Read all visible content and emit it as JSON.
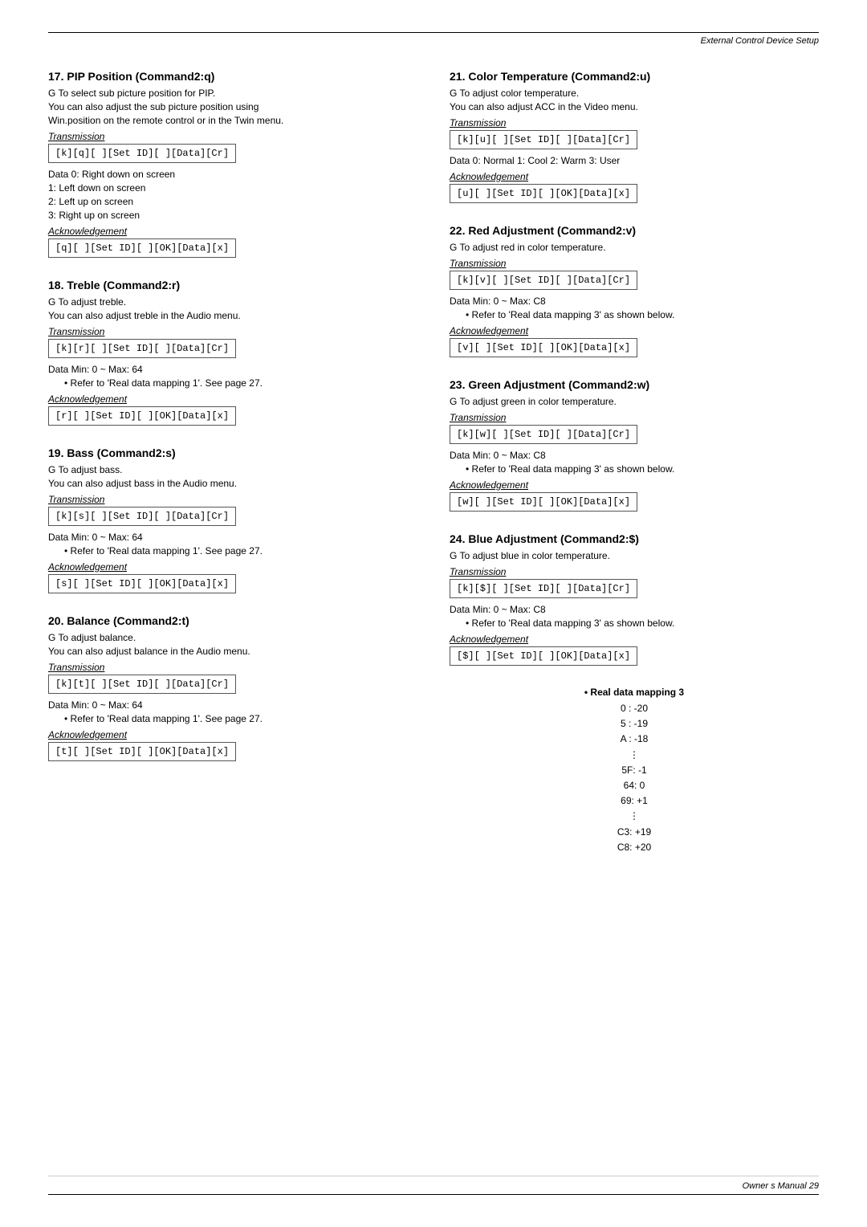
{
  "header": {
    "text": "External Control Device Setup"
  },
  "footer": {
    "text": "Owner s Manual  29"
  },
  "left_column": [
    {
      "id": "section-17",
      "title": "17. PIP Position (Command2:q)",
      "description_lines": [
        "G  To select sub picture position for PIP.",
        "     You can also adjust the sub picture position using",
        "     Win.position on the remote control or in the Twin menu."
      ],
      "transmission_label": "Transmission",
      "transmission_cmd": "[k][q][   ][Set ID][   ][Data][Cr]",
      "data_lines": [
        "Data  0: Right down on screen",
        "         1: Left down on screen",
        "         2: Left up on screen",
        "         3: Right up on screen"
      ],
      "ack_label": "Acknowledgement",
      "ack_cmd": "[q][   ][Set ID][   ][OK][Data][x]",
      "bullets": []
    },
    {
      "id": "section-18",
      "title": "18. Treble (Command2:r)",
      "description_lines": [
        "G  To adjust treble.",
        "     You can also adjust treble in the Audio menu."
      ],
      "transmission_label": "Transmission",
      "transmission_cmd": "[k][r][   ][Set ID][   ][Data][Cr]",
      "data_lines": [
        "Data  Min: 0 ~ Max: 64"
      ],
      "ack_label": "Acknowledgement",
      "ack_cmd": "[r][   ][Set ID][   ][OK][Data][x]",
      "bullets": [
        "Refer to 'Real data mapping 1'. See page 27."
      ]
    },
    {
      "id": "section-19",
      "title": "19. Bass (Command2:s)",
      "description_lines": [
        "G  To adjust bass.",
        "     You can also adjust bass in the Audio menu."
      ],
      "transmission_label": "Transmission",
      "transmission_cmd": "[k][s][   ][Set ID][   ][Data][Cr]",
      "data_lines": [
        "Data  Min: 0 ~ Max: 64"
      ],
      "ack_label": "Acknowledgement",
      "ack_cmd": "[s][   ][Set ID][   ][OK][Data][x]",
      "bullets": [
        "Refer to 'Real data mapping 1'. See page 27."
      ]
    },
    {
      "id": "section-20",
      "title": "20. Balance (Command2:t)",
      "description_lines": [
        "G  To adjust balance.",
        "     You can also adjust balance in the Audio menu."
      ],
      "transmission_label": "Transmission",
      "transmission_cmd": "[k][t][   ][Set ID][   ][Data][Cr]",
      "data_lines": [
        "Data  Min: 0 ~ Max: 64"
      ],
      "ack_label": "Acknowledgement",
      "ack_cmd": "[t][   ][Set ID][   ][OK][Data][x]",
      "bullets": [
        "Refer to 'Real data mapping 1'. See page 27."
      ]
    }
  ],
  "right_column": [
    {
      "id": "section-21",
      "title": "21. Color Temperature (Command2:u)",
      "description_lines": [
        "G  To adjust color temperature.",
        "     You can also adjust ACC in the Video menu."
      ],
      "transmission_label": "Transmission",
      "transmission_cmd": "[k][u][   ][Set ID][   ][Data][Cr]",
      "data_lines": [
        "Data  0: Normal    1: Cool    2: Warm    3: User"
      ],
      "ack_label": "Acknowledgement",
      "ack_cmd": "[u][   ][Set ID][   ][OK][Data][x]",
      "bullets": []
    },
    {
      "id": "section-22",
      "title": "22. Red Adjustment (Command2:v)",
      "description_lines": [
        "G  To adjust red in color temperature."
      ],
      "transmission_label": "Transmission",
      "transmission_cmd": "[k][v][   ][Set ID][   ][Data][Cr]",
      "data_lines": [
        "Data  Min: 0 ~ Max: C8"
      ],
      "ack_label": "Acknowledgement",
      "ack_cmd": "[v][   ][Set ID][   ][OK][Data][x]",
      "bullets": [
        "Refer to 'Real data mapping 3' as shown below."
      ]
    },
    {
      "id": "section-23",
      "title": "23. Green Adjustment (Command2:w)",
      "description_lines": [
        "G  To adjust green in color temperature."
      ],
      "transmission_label": "Transmission",
      "transmission_cmd": "[k][w][   ][Set ID][   ][Data][Cr]",
      "data_lines": [
        "Data  Min: 0 ~ Max: C8"
      ],
      "ack_label": "Acknowledgement",
      "ack_cmd": "[w][   ][Set ID][   ][OK][Data][x]",
      "bullets": [
        "Refer to 'Real data mapping 3' as shown below."
      ]
    },
    {
      "id": "section-24",
      "title": "24. Blue Adjustment (Command2:$)",
      "description_lines": [
        "G  To adjust blue in color temperature."
      ],
      "transmission_label": "Transmission",
      "transmission_cmd": "[k][$][   ][Set ID][   ][Data][Cr]",
      "data_lines": [
        "Data  Min: 0 ~ Max: C8"
      ],
      "ack_label": "Acknowledgement",
      "ack_cmd": "[$][   ][Set ID][   ][OK][Data][x]",
      "bullets": [
        "Refer to 'Real data mapping  3' as shown below."
      ]
    }
  ],
  "real_data_mapping": {
    "title": "Real data mapping 3",
    "entries": [
      "0  : -20",
      "5  : -19",
      "A  : -18",
      "⋮",
      "5F: -1",
      "64: 0",
      "69: +1",
      "⋮",
      "C3: +19",
      "C8: +20"
    ]
  }
}
